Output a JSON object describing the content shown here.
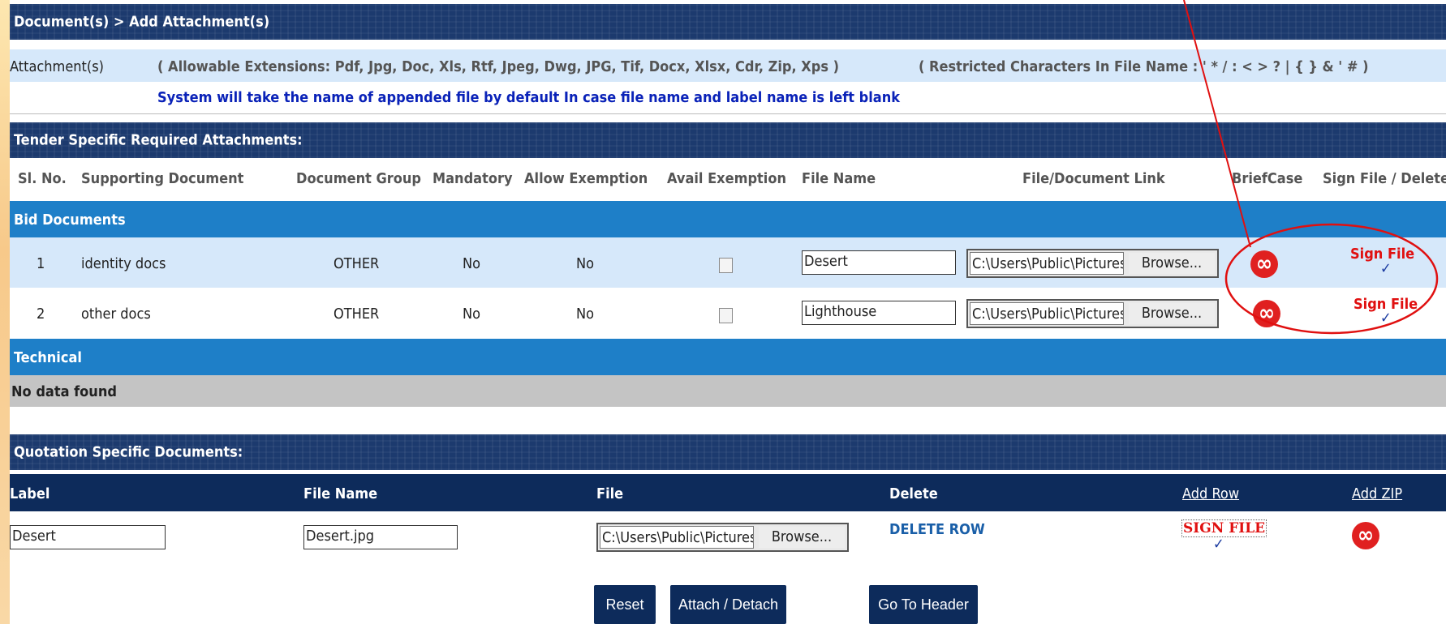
{
  "breadcrumb": "Document(s) > Add Attachment(s)",
  "attachment": {
    "label": "Attachment(s)",
    "allowable": "( Allowable Extensions: Pdf, Jpg, Doc, Xls, Rtf, Jpeg, Dwg, JPG, Tif, Docx, Xlsx, Cdr, Zip, Xps )",
    "restricted": "( Restricted Characters In File Name : ' * / : < > ? | { } & ' # )",
    "note": "System will take the name of appended file by default In case file name and label name is left blank"
  },
  "tender": {
    "title": "Tender Specific Required Attachments:",
    "columns": [
      "Sl. No.",
      "Supporting Document",
      "Document Group",
      "Mandatory",
      "Allow Exemption",
      "Avail Exemption",
      "File Name",
      "File/Document Link",
      "BriefCase",
      "Sign File / Delete"
    ],
    "bid_group": "Bid Documents",
    "rows": [
      {
        "sl": "1",
        "doc": "identity docs",
        "group": "OTHER",
        "mandatory": "No",
        "allow": "No",
        "file_name": "Desert",
        "path": "C:\\Users\\Public\\Pictures\\Sample Pictures\\Desert.jpg",
        "browse": "Browse...",
        "sign": "Sign File",
        "check": "✓"
      },
      {
        "sl": "2",
        "doc": "other docs",
        "group": "OTHER",
        "mandatory": "No",
        "allow": "No",
        "file_name": "Lighthouse",
        "path": "C:\\Users\\Public\\Pictures\\Sample Pictures\\Lighthouse.jpg",
        "browse": "Browse...",
        "sign": "Sign File",
        "check": "✓"
      }
    ],
    "technical_group": "Technical",
    "no_data": "No data found"
  },
  "quotation": {
    "title": "Quotation Specific Documents:",
    "columns": {
      "label": "Label",
      "file_name": "File Name",
      "file": "File",
      "delete": "Delete",
      "add_row": "Add Row",
      "add_zip": "Add ZIP"
    },
    "row": {
      "label": "Desert",
      "file_name": "Desert.jpg",
      "path": "C:\\Users\\Public\\Pictures\\Sample Pictures\\Desert.jpg",
      "browse": "Browse...",
      "delete": "DELETE ROW",
      "sign": "SIGN FILE",
      "check": "✓"
    }
  },
  "buttons": {
    "reset": "Reset",
    "attach": "Attach / Detach",
    "header": "Go To Header"
  },
  "colors": {
    "navy": "#1c3a6e",
    "blue_band": "#1e7fc8",
    "light_row": "#d6e8fa",
    "red": "#e01010",
    "annotation": "#e01010"
  },
  "icons": [
    "briefcase-icon",
    "checkmark-icon"
  ]
}
